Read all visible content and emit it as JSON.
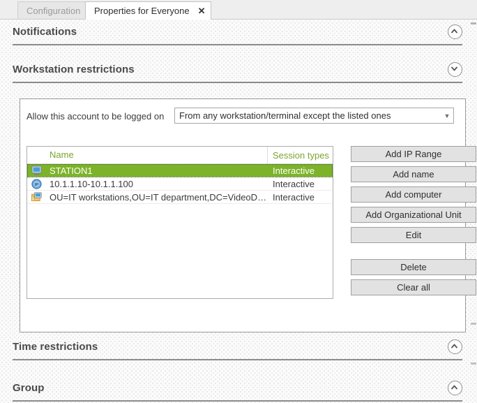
{
  "tabs": [
    {
      "label": "Configuration",
      "active": false,
      "closable": false
    },
    {
      "label": "Properties for Everyone",
      "active": true,
      "closable": true,
      "close_glyph": "✕"
    }
  ],
  "sections": {
    "notifications": {
      "title": "Notifications",
      "state": "collapsed",
      "chevron": "chevron-up-icon"
    },
    "workstation": {
      "title": "Workstation restrictions",
      "state": "expanded",
      "chevron": "chevron-down-icon"
    },
    "time": {
      "title": "Time restrictions",
      "state": "collapsed",
      "chevron": "chevron-up-icon"
    },
    "group": {
      "title": "Group",
      "state": "collapsed",
      "chevron": "chevron-up-icon"
    }
  },
  "workstation_restrictions": {
    "allow_label": "Allow this account to be logged on",
    "logon_mode": {
      "selected": "From any workstation/terminal except the listed ones",
      "arrow_glyph": "▼"
    },
    "list": {
      "columns": [
        "Name",
        "Session types"
      ],
      "rows": [
        {
          "icon": "computer-icon",
          "name": "STATION1",
          "session_type": "Interactive",
          "selected": true
        },
        {
          "icon": "ip-address-icon",
          "name": "10.1.1.10-10.1.1.100",
          "session_type": "Interactive",
          "selected": false
        },
        {
          "icon": "organizational-unit-icon",
          "name": "OU=IT workstations,OU=IT department,DC=VideoDemo,...",
          "session_type": "Interactive",
          "selected": false
        }
      ]
    },
    "buttons": {
      "add_ip_range": "Add IP Range",
      "add_name": "Add name",
      "add_computer": "Add computer",
      "add_organizational_unit": "Add Organizational Unit",
      "edit": "Edit",
      "delete": "Delete",
      "clear_all": "Clear all"
    }
  },
  "colors": {
    "accent_green": "#7cb32a",
    "header_green": "#7aa531",
    "panel_bg": "#ffffff",
    "page_bg": "#fbfbfb",
    "button_face": "#e2e2e2"
  }
}
